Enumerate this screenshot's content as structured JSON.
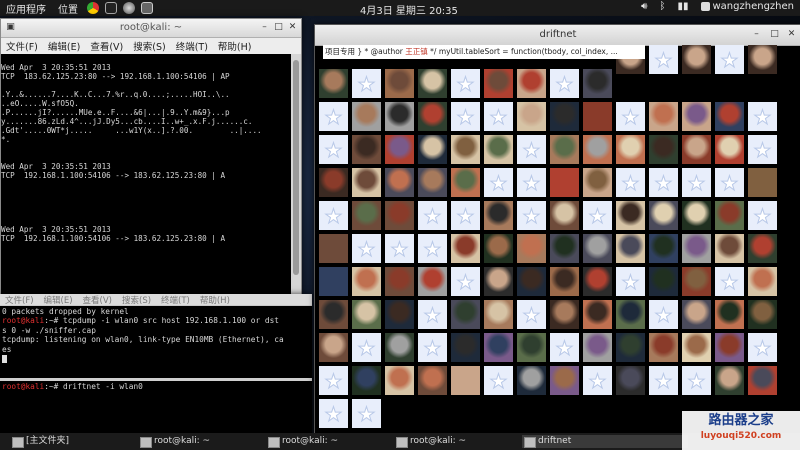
{
  "topbar": {
    "applications": "应用程序",
    "places": "位置",
    "clock": "4月3日 星期三 20:35",
    "user": "wangzhengzhen",
    "app_icons": [
      "chrome-icon",
      "terminal-icon",
      "orb-icon",
      "screenshot-icon"
    ],
    "tray_icons": [
      "volume-icon",
      "bluetooth-icon",
      "network-icon",
      "user-icon"
    ]
  },
  "terminal1": {
    "title": "root@kali: ~",
    "menu": [
      "文件(F)",
      "编辑(E)",
      "查看(V)",
      "搜索(S)",
      "终端(T)",
      "帮助(H)"
    ],
    "lines": [
      "",
      "Wed Apr  3 20:35:51 2013",
      "TCP  183.62.125.23:80 --> 192.168.1.100:54106 | AP",
      "",
      ".Y..&......7....K..C...7.%r..q.0....;.....HOI..\\..",
      "..eO.....W.sfO5Q.",
      ".P......jI?......MUe.e..F....&6|...|.9..Y.m&9}...p",
      "y.......86.zLd.4^...jJ.Dy5...cb....I..w+_.x.F.j......c.",
      ".Gdt'.....0WT*j.....     ...w1Y(x..].?.00.        ..|....",
      "*.",
      "",
      "",
      "Wed Apr  3 20:35:51 2013",
      "TCP  192.168.1.100:54106 --> 183.62.125.23:80 | A",
      "",
      "",
      "",
      "",
      "",
      "Wed Apr  3 20:35:51 2013",
      "TCP  192.168.1.100:54106 --> 183.62.125.23:80 | A"
    ]
  },
  "terminal2": {
    "menu": [
      "文件(F)",
      "编辑(E)",
      "查看(V)",
      "搜索(S)",
      "终端(T)",
      "帮助(H)"
    ],
    "line0": "0 packets dropped by kernel",
    "prompt": "root@kali",
    "cmd": ":~# tcpdump -i wlan0 src host 192.168.1.100 or dst",
    "line2": "s 0 -w ./sniffer.cap",
    "line3": "tcpdump: listening on wlan0, link-type EN10MB (Ethernet), ca",
    "line4": "es"
  },
  "terminal3": {
    "prompt": "root@kali",
    "cmd": ":~# driftnet -i wlan0"
  },
  "driftnet": {
    "title": "driftnet",
    "code_prefix": "项目专用 } * @author ",
    "code_author": "王正镇",
    "code_suffix": " */ myUtil.tableSort = function(tbody, col_index, ..."
  },
  "taskbar": {
    "items": [
      "[主文件夹]",
      "root@kali: ~",
      "root@kali: ~",
      "root@kali: ~",
      "driftnet"
    ]
  },
  "watermark": {
    "line1": "路由器之家",
    "line2": "luyouqi520.com"
  }
}
